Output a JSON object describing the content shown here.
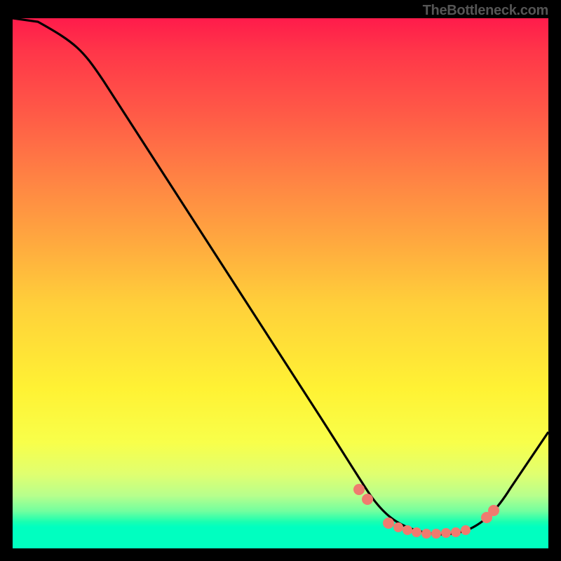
{
  "attribution": "TheBottleneck.com",
  "chart_data": {
    "type": "line",
    "title": "",
    "xlabel": "",
    "ylabel": "",
    "xlim": [
      0,
      100
    ],
    "ylim": [
      0,
      100
    ],
    "series": [
      {
        "name": "bottleneck-curve",
        "x": [
          0,
          4,
          12,
          55,
          64,
          70,
          76,
          82,
          88,
          100
        ],
        "y": [
          100,
          99.5,
          95,
          28,
          12,
          5,
          2.5,
          2.5,
          5,
          20
        ]
      }
    ],
    "markers": {
      "name": "optimum-points",
      "x": [
        64,
        66,
        70,
        72,
        74,
        76,
        78,
        80,
        82,
        84,
        88,
        89
      ],
      "y": [
        11,
        9,
        4.5,
        3.5,
        3,
        2.5,
        2.5,
        2.5,
        2.5,
        3,
        6,
        7.5
      ]
    },
    "background": "heat-gradient-vertical"
  }
}
